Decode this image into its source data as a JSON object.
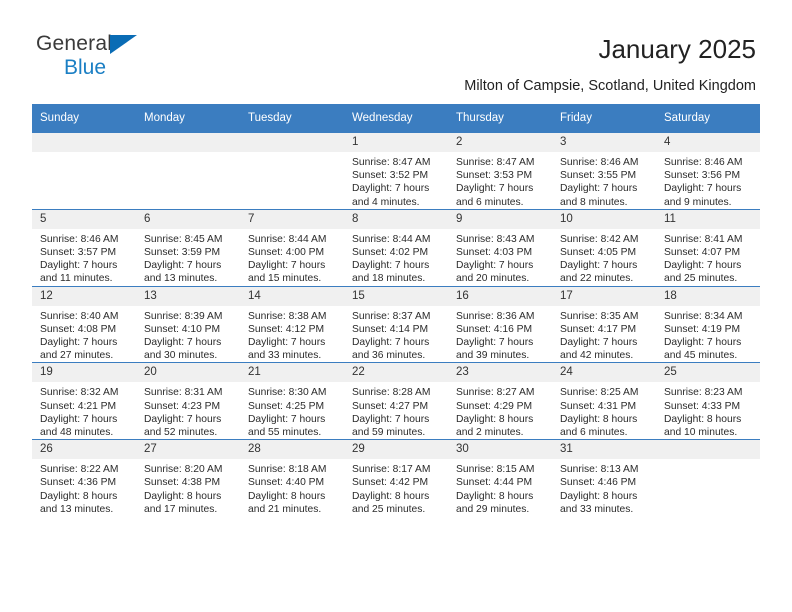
{
  "brand": {
    "line1": "General",
    "line2": "Blue",
    "triangle_color": "#0a6cb5"
  },
  "header": {
    "title": "January 2025",
    "subtitle": "Milton of Campsie, Scotland, United Kingdom"
  },
  "theme": {
    "header_blue": "#3b7dc0",
    "daynum_gray": "#f0f0f0",
    "text": "#2b2b2b"
  },
  "weekdays": [
    "Sunday",
    "Monday",
    "Tuesday",
    "Wednesday",
    "Thursday",
    "Friday",
    "Saturday"
  ],
  "weeks": [
    [
      {
        "day": "",
        "sunrise": "",
        "sunset": "",
        "daylight1": "",
        "daylight2": ""
      },
      {
        "day": "",
        "sunrise": "",
        "sunset": "",
        "daylight1": "",
        "daylight2": ""
      },
      {
        "day": "",
        "sunrise": "",
        "sunset": "",
        "daylight1": "",
        "daylight2": ""
      },
      {
        "day": "1",
        "sunrise": "Sunrise: 8:47 AM",
        "sunset": "Sunset: 3:52 PM",
        "daylight1": "Daylight: 7 hours",
        "daylight2": "and 4 minutes."
      },
      {
        "day": "2",
        "sunrise": "Sunrise: 8:47 AM",
        "sunset": "Sunset: 3:53 PM",
        "daylight1": "Daylight: 7 hours",
        "daylight2": "and 6 minutes."
      },
      {
        "day": "3",
        "sunrise": "Sunrise: 8:46 AM",
        "sunset": "Sunset: 3:55 PM",
        "daylight1": "Daylight: 7 hours",
        "daylight2": "and 8 minutes."
      },
      {
        "day": "4",
        "sunrise": "Sunrise: 8:46 AM",
        "sunset": "Sunset: 3:56 PM",
        "daylight1": "Daylight: 7 hours",
        "daylight2": "and 9 minutes."
      }
    ],
    [
      {
        "day": "5",
        "sunrise": "Sunrise: 8:46 AM",
        "sunset": "Sunset: 3:57 PM",
        "daylight1": "Daylight: 7 hours",
        "daylight2": "and 11 minutes."
      },
      {
        "day": "6",
        "sunrise": "Sunrise: 8:45 AM",
        "sunset": "Sunset: 3:59 PM",
        "daylight1": "Daylight: 7 hours",
        "daylight2": "and 13 minutes."
      },
      {
        "day": "7",
        "sunrise": "Sunrise: 8:44 AM",
        "sunset": "Sunset: 4:00 PM",
        "daylight1": "Daylight: 7 hours",
        "daylight2": "and 15 minutes."
      },
      {
        "day": "8",
        "sunrise": "Sunrise: 8:44 AM",
        "sunset": "Sunset: 4:02 PM",
        "daylight1": "Daylight: 7 hours",
        "daylight2": "and 18 minutes."
      },
      {
        "day": "9",
        "sunrise": "Sunrise: 8:43 AM",
        "sunset": "Sunset: 4:03 PM",
        "daylight1": "Daylight: 7 hours",
        "daylight2": "and 20 minutes."
      },
      {
        "day": "10",
        "sunrise": "Sunrise: 8:42 AM",
        "sunset": "Sunset: 4:05 PM",
        "daylight1": "Daylight: 7 hours",
        "daylight2": "and 22 minutes."
      },
      {
        "day": "11",
        "sunrise": "Sunrise: 8:41 AM",
        "sunset": "Sunset: 4:07 PM",
        "daylight1": "Daylight: 7 hours",
        "daylight2": "and 25 minutes."
      }
    ],
    [
      {
        "day": "12",
        "sunrise": "Sunrise: 8:40 AM",
        "sunset": "Sunset: 4:08 PM",
        "daylight1": "Daylight: 7 hours",
        "daylight2": "and 27 minutes."
      },
      {
        "day": "13",
        "sunrise": "Sunrise: 8:39 AM",
        "sunset": "Sunset: 4:10 PM",
        "daylight1": "Daylight: 7 hours",
        "daylight2": "and 30 minutes."
      },
      {
        "day": "14",
        "sunrise": "Sunrise: 8:38 AM",
        "sunset": "Sunset: 4:12 PM",
        "daylight1": "Daylight: 7 hours",
        "daylight2": "and 33 minutes."
      },
      {
        "day": "15",
        "sunrise": "Sunrise: 8:37 AM",
        "sunset": "Sunset: 4:14 PM",
        "daylight1": "Daylight: 7 hours",
        "daylight2": "and 36 minutes."
      },
      {
        "day": "16",
        "sunrise": "Sunrise: 8:36 AM",
        "sunset": "Sunset: 4:16 PM",
        "daylight1": "Daylight: 7 hours",
        "daylight2": "and 39 minutes."
      },
      {
        "day": "17",
        "sunrise": "Sunrise: 8:35 AM",
        "sunset": "Sunset: 4:17 PM",
        "daylight1": "Daylight: 7 hours",
        "daylight2": "and 42 minutes."
      },
      {
        "day": "18",
        "sunrise": "Sunrise: 8:34 AM",
        "sunset": "Sunset: 4:19 PM",
        "daylight1": "Daylight: 7 hours",
        "daylight2": "and 45 minutes."
      }
    ],
    [
      {
        "day": "19",
        "sunrise": "Sunrise: 8:32 AM",
        "sunset": "Sunset: 4:21 PM",
        "daylight1": "Daylight: 7 hours",
        "daylight2": "and 48 minutes."
      },
      {
        "day": "20",
        "sunrise": "Sunrise: 8:31 AM",
        "sunset": "Sunset: 4:23 PM",
        "daylight1": "Daylight: 7 hours",
        "daylight2": "and 52 minutes."
      },
      {
        "day": "21",
        "sunrise": "Sunrise: 8:30 AM",
        "sunset": "Sunset: 4:25 PM",
        "daylight1": "Daylight: 7 hours",
        "daylight2": "and 55 minutes."
      },
      {
        "day": "22",
        "sunrise": "Sunrise: 8:28 AM",
        "sunset": "Sunset: 4:27 PM",
        "daylight1": "Daylight: 7 hours",
        "daylight2": "and 59 minutes."
      },
      {
        "day": "23",
        "sunrise": "Sunrise: 8:27 AM",
        "sunset": "Sunset: 4:29 PM",
        "daylight1": "Daylight: 8 hours",
        "daylight2": "and 2 minutes."
      },
      {
        "day": "24",
        "sunrise": "Sunrise: 8:25 AM",
        "sunset": "Sunset: 4:31 PM",
        "daylight1": "Daylight: 8 hours",
        "daylight2": "and 6 minutes."
      },
      {
        "day": "25",
        "sunrise": "Sunrise: 8:23 AM",
        "sunset": "Sunset: 4:33 PM",
        "daylight1": "Daylight: 8 hours",
        "daylight2": "and 10 minutes."
      }
    ],
    [
      {
        "day": "26",
        "sunrise": "Sunrise: 8:22 AM",
        "sunset": "Sunset: 4:36 PM",
        "daylight1": "Daylight: 8 hours",
        "daylight2": "and 13 minutes."
      },
      {
        "day": "27",
        "sunrise": "Sunrise: 8:20 AM",
        "sunset": "Sunset: 4:38 PM",
        "daylight1": "Daylight: 8 hours",
        "daylight2": "and 17 minutes."
      },
      {
        "day": "28",
        "sunrise": "Sunrise: 8:18 AM",
        "sunset": "Sunset: 4:40 PM",
        "daylight1": "Daylight: 8 hours",
        "daylight2": "and 21 minutes."
      },
      {
        "day": "29",
        "sunrise": "Sunrise: 8:17 AM",
        "sunset": "Sunset: 4:42 PM",
        "daylight1": "Daylight: 8 hours",
        "daylight2": "and 25 minutes."
      },
      {
        "day": "30",
        "sunrise": "Sunrise: 8:15 AM",
        "sunset": "Sunset: 4:44 PM",
        "daylight1": "Daylight: 8 hours",
        "daylight2": "and 29 minutes."
      },
      {
        "day": "31",
        "sunrise": "Sunrise: 8:13 AM",
        "sunset": "Sunset: 4:46 PM",
        "daylight1": "Daylight: 8 hours",
        "daylight2": "and 33 minutes."
      },
      {
        "day": "",
        "sunrise": "",
        "sunset": "",
        "daylight1": "",
        "daylight2": ""
      }
    ]
  ]
}
